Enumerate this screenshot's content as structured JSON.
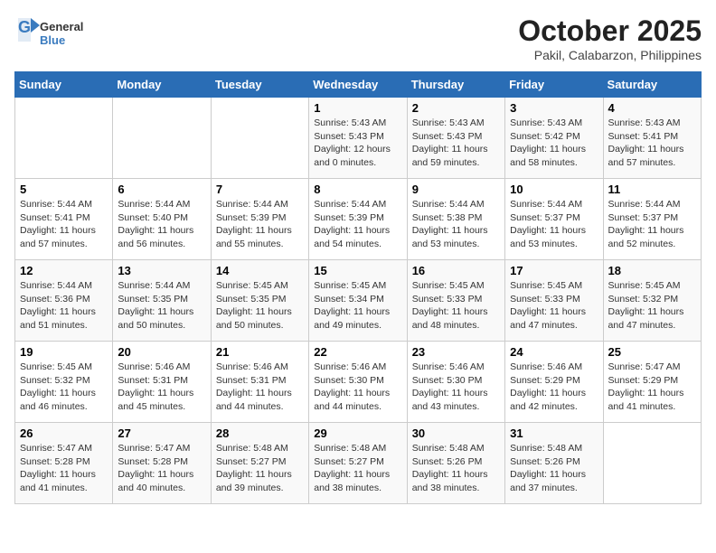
{
  "header": {
    "logo_general": "General",
    "logo_blue": "Blue",
    "title": "October 2025",
    "subtitle": "Pakil, Calabarzon, Philippines"
  },
  "calendar": {
    "weekdays": [
      "Sunday",
      "Monday",
      "Tuesday",
      "Wednesday",
      "Thursday",
      "Friday",
      "Saturday"
    ],
    "weeks": [
      [
        {
          "day": "",
          "info": ""
        },
        {
          "day": "",
          "info": ""
        },
        {
          "day": "",
          "info": ""
        },
        {
          "day": "1",
          "info": "Sunrise: 5:43 AM\nSunset: 5:43 PM\nDaylight: 12 hours\nand 0 minutes."
        },
        {
          "day": "2",
          "info": "Sunrise: 5:43 AM\nSunset: 5:43 PM\nDaylight: 11 hours\nand 59 minutes."
        },
        {
          "day": "3",
          "info": "Sunrise: 5:43 AM\nSunset: 5:42 PM\nDaylight: 11 hours\nand 58 minutes."
        },
        {
          "day": "4",
          "info": "Sunrise: 5:43 AM\nSunset: 5:41 PM\nDaylight: 11 hours\nand 57 minutes."
        }
      ],
      [
        {
          "day": "5",
          "info": "Sunrise: 5:44 AM\nSunset: 5:41 PM\nDaylight: 11 hours\nand 57 minutes."
        },
        {
          "day": "6",
          "info": "Sunrise: 5:44 AM\nSunset: 5:40 PM\nDaylight: 11 hours\nand 56 minutes."
        },
        {
          "day": "7",
          "info": "Sunrise: 5:44 AM\nSunset: 5:39 PM\nDaylight: 11 hours\nand 55 minutes."
        },
        {
          "day": "8",
          "info": "Sunrise: 5:44 AM\nSunset: 5:39 PM\nDaylight: 11 hours\nand 54 minutes."
        },
        {
          "day": "9",
          "info": "Sunrise: 5:44 AM\nSunset: 5:38 PM\nDaylight: 11 hours\nand 53 minutes."
        },
        {
          "day": "10",
          "info": "Sunrise: 5:44 AM\nSunset: 5:37 PM\nDaylight: 11 hours\nand 53 minutes."
        },
        {
          "day": "11",
          "info": "Sunrise: 5:44 AM\nSunset: 5:37 PM\nDaylight: 11 hours\nand 52 minutes."
        }
      ],
      [
        {
          "day": "12",
          "info": "Sunrise: 5:44 AM\nSunset: 5:36 PM\nDaylight: 11 hours\nand 51 minutes."
        },
        {
          "day": "13",
          "info": "Sunrise: 5:44 AM\nSunset: 5:35 PM\nDaylight: 11 hours\nand 50 minutes."
        },
        {
          "day": "14",
          "info": "Sunrise: 5:45 AM\nSunset: 5:35 PM\nDaylight: 11 hours\nand 50 minutes."
        },
        {
          "day": "15",
          "info": "Sunrise: 5:45 AM\nSunset: 5:34 PM\nDaylight: 11 hours\nand 49 minutes."
        },
        {
          "day": "16",
          "info": "Sunrise: 5:45 AM\nSunset: 5:33 PM\nDaylight: 11 hours\nand 48 minutes."
        },
        {
          "day": "17",
          "info": "Sunrise: 5:45 AM\nSunset: 5:33 PM\nDaylight: 11 hours\nand 47 minutes."
        },
        {
          "day": "18",
          "info": "Sunrise: 5:45 AM\nSunset: 5:32 PM\nDaylight: 11 hours\nand 47 minutes."
        }
      ],
      [
        {
          "day": "19",
          "info": "Sunrise: 5:45 AM\nSunset: 5:32 PM\nDaylight: 11 hours\nand 46 minutes."
        },
        {
          "day": "20",
          "info": "Sunrise: 5:46 AM\nSunset: 5:31 PM\nDaylight: 11 hours\nand 45 minutes."
        },
        {
          "day": "21",
          "info": "Sunrise: 5:46 AM\nSunset: 5:31 PM\nDaylight: 11 hours\nand 44 minutes."
        },
        {
          "day": "22",
          "info": "Sunrise: 5:46 AM\nSunset: 5:30 PM\nDaylight: 11 hours\nand 44 minutes."
        },
        {
          "day": "23",
          "info": "Sunrise: 5:46 AM\nSunset: 5:30 PM\nDaylight: 11 hours\nand 43 minutes."
        },
        {
          "day": "24",
          "info": "Sunrise: 5:46 AM\nSunset: 5:29 PM\nDaylight: 11 hours\nand 42 minutes."
        },
        {
          "day": "25",
          "info": "Sunrise: 5:47 AM\nSunset: 5:29 PM\nDaylight: 11 hours\nand 41 minutes."
        }
      ],
      [
        {
          "day": "26",
          "info": "Sunrise: 5:47 AM\nSunset: 5:28 PM\nDaylight: 11 hours\nand 41 minutes."
        },
        {
          "day": "27",
          "info": "Sunrise: 5:47 AM\nSunset: 5:28 PM\nDaylight: 11 hours\nand 40 minutes."
        },
        {
          "day": "28",
          "info": "Sunrise: 5:48 AM\nSunset: 5:27 PM\nDaylight: 11 hours\nand 39 minutes."
        },
        {
          "day": "29",
          "info": "Sunrise: 5:48 AM\nSunset: 5:27 PM\nDaylight: 11 hours\nand 38 minutes."
        },
        {
          "day": "30",
          "info": "Sunrise: 5:48 AM\nSunset: 5:26 PM\nDaylight: 11 hours\nand 38 minutes."
        },
        {
          "day": "31",
          "info": "Sunrise: 5:48 AM\nSunset: 5:26 PM\nDaylight: 11 hours\nand 37 minutes."
        },
        {
          "day": "",
          "info": ""
        }
      ]
    ]
  }
}
